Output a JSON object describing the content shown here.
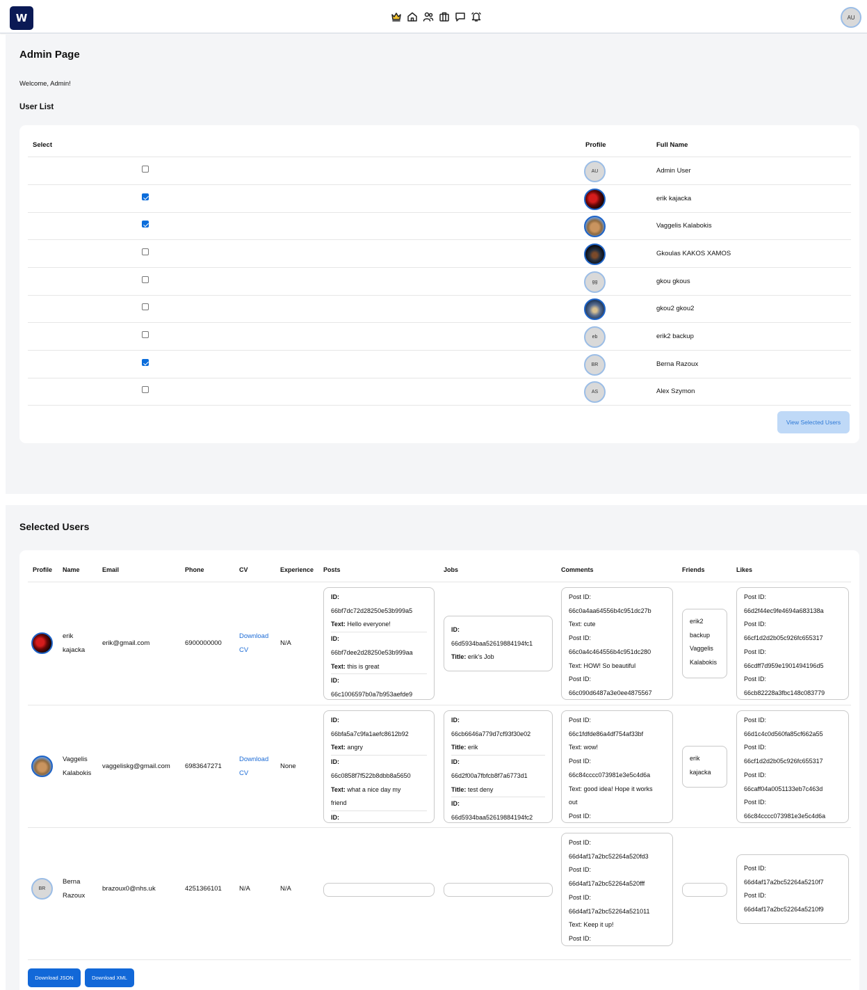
{
  "header": {
    "logo_text": "W",
    "nav_icons": [
      "crown-icon",
      "home-icon",
      "users-icon",
      "briefcase-icon",
      "message-icon",
      "bell-icon"
    ],
    "avatar_initials": "AU"
  },
  "page": {
    "title": "Admin Page",
    "welcome": "Welcome, Admin!",
    "user_list_title": "User List"
  },
  "user_table": {
    "headers": {
      "select": "Select",
      "profile": "Profile",
      "full_name": "Full Name"
    },
    "rows": [
      {
        "checked": false,
        "initials": "AU",
        "name": "Admin User"
      },
      {
        "checked": true,
        "initials": "",
        "name": "erik kajacka"
      },
      {
        "checked": true,
        "initials": "",
        "name": "Vaggelis Kalabokis"
      },
      {
        "checked": false,
        "initials": "",
        "name": "Gkoulas KAKOS XAMOS"
      },
      {
        "checked": false,
        "initials": "gg",
        "name": "gkou gkous"
      },
      {
        "checked": false,
        "initials": "",
        "name": "gkou2 gkou2"
      },
      {
        "checked": false,
        "initials": "eb",
        "name": "erik2 backup"
      },
      {
        "checked": true,
        "initials": "BR",
        "name": "Berna Razoux"
      },
      {
        "checked": false,
        "initials": "AS",
        "name": "Alex Szymon"
      }
    ],
    "view_button": "View Selected Users"
  },
  "selected": {
    "title": "Selected Users",
    "headers": {
      "profile": "Profile",
      "name": "Name",
      "email": "Email",
      "phone": "Phone",
      "cv": "CV",
      "experience": "Experience",
      "posts": "Posts",
      "jobs": "Jobs",
      "comments": "Comments",
      "friends": "Friends",
      "likes": "Likes"
    },
    "rows": [
      {
        "name_line1": "erik",
        "name_line2": "kajacka",
        "email": "erik@gmail.com",
        "phone": "6900000000",
        "cv_line1": "Download",
        "cv_line2": "CV",
        "experience": "N/A",
        "posts": {
          "id_label": "ID:",
          "text_label": "Text:",
          "p1_id": "66bf7dc72d28250e53b999a5",
          "p1_text": "Hello everyone!",
          "p2_id": "66bf7dee2d28250e53b999aa",
          "p2_text": "this is great",
          "p3_id": "66c1006597b0a7b953aefde9"
        },
        "jobs": {
          "id_label": "ID:",
          "title_label": "Title:",
          "j1_id": "66d5934baa52619884194fc1",
          "j1_title": "erik's Job"
        },
        "comments": {
          "post_label": "Post ID:",
          "text_label": "Text:",
          "c1_id": "66c0a4aa64556b4c951dc27b",
          "c1_text": "cute",
          "c2_id": "66c0a4c464556b4c951dc280",
          "c2_text": "HOW! So beautiful",
          "c3_id": "66c090d6487a3e0ee4875567"
        },
        "friends": [
          "erik2",
          "backup",
          "Vaggelis",
          "Kalabokis"
        ],
        "likes": {
          "post_label": "Post ID:",
          "items": [
            "66d2f44ec9fe4694a683138a",
            "66cf1d2d2b05c926fc655317",
            "66cdff7d959e1901494196d5",
            "66cb82228a3fbc148c083779"
          ]
        }
      },
      {
        "name_line1": "Vaggelis",
        "name_line2": "Kalabokis",
        "email": "vaggeliskg@gmail.com",
        "phone": "6983647271",
        "cv_line1": "Download",
        "cv_line2": "CV",
        "experience": "None",
        "posts": {
          "id_label": "ID:",
          "text_label": "Text:",
          "p1_id": "66bfa5a7c9fa1aefc8612b92",
          "p1_text": "angry",
          "p2_id": "66c0858f7f522b8dbb8a5650",
          "p2_text": "what a nice day my",
          "p2_text_cont": "friend",
          "p3_id": ""
        },
        "jobs": {
          "id_label": "ID:",
          "title_label": "Title:",
          "j1_id": "66cb6646a779d7cf93f30e02",
          "j1_title": "erik",
          "j2_id": "66d2f00a7fbfcb8f7a6773d1",
          "j2_title": "test deny",
          "j3_id": "66d5934baa52619884194fc2"
        },
        "comments": {
          "post_label": "Post ID:",
          "text_label": "Text:",
          "c1_id": "66c1fdfde86a4df754af33bf",
          "c1_text": "wow!",
          "c2_id": "66c84cccc073981e3e5c4d6a",
          "c2_text": "good idea! Hope it works",
          "c2_text_cont": "out"
        },
        "friends": [
          "erik",
          "kajacka"
        ],
        "likes": {
          "post_label": "Post ID:",
          "items": [
            "66d1c4c0d560fa85cf662a55",
            "66cf1d2d2b05c926fc655317",
            "66caff04a0051133eb7c463d",
            "66c84cccc073981e3e5c4d6a"
          ]
        }
      },
      {
        "initials": "BR",
        "name_line1": "Berna",
        "name_line2": "Razoux",
        "email": "brazoux0@nhs.uk",
        "phone": "4251366101",
        "cv": "N/A",
        "experience": "N/A",
        "comments": {
          "post_label": "Post ID:",
          "text_label": "Text:",
          "c1_id": "66d4af17a2bc52264a520fd3",
          "c2_id": "66d4af17a2bc52264a520fff",
          "c3_id": "66d4af17a2bc52264a521011",
          "c3_text": "Keep it up!"
        },
        "likes": {
          "post_label": "Post ID:",
          "items": [
            "66d4af17a2bc52264a5210f7",
            "66d4af17a2bc52264a5210f9"
          ]
        }
      }
    ],
    "download_json": "Download JSON",
    "download_xml": "Download XML"
  },
  "colors": {
    "brand": "#0b1a55",
    "primary": "#1268d8",
    "view_btn_bg": "#bfd9f7",
    "bg": "#f4f5f7"
  }
}
